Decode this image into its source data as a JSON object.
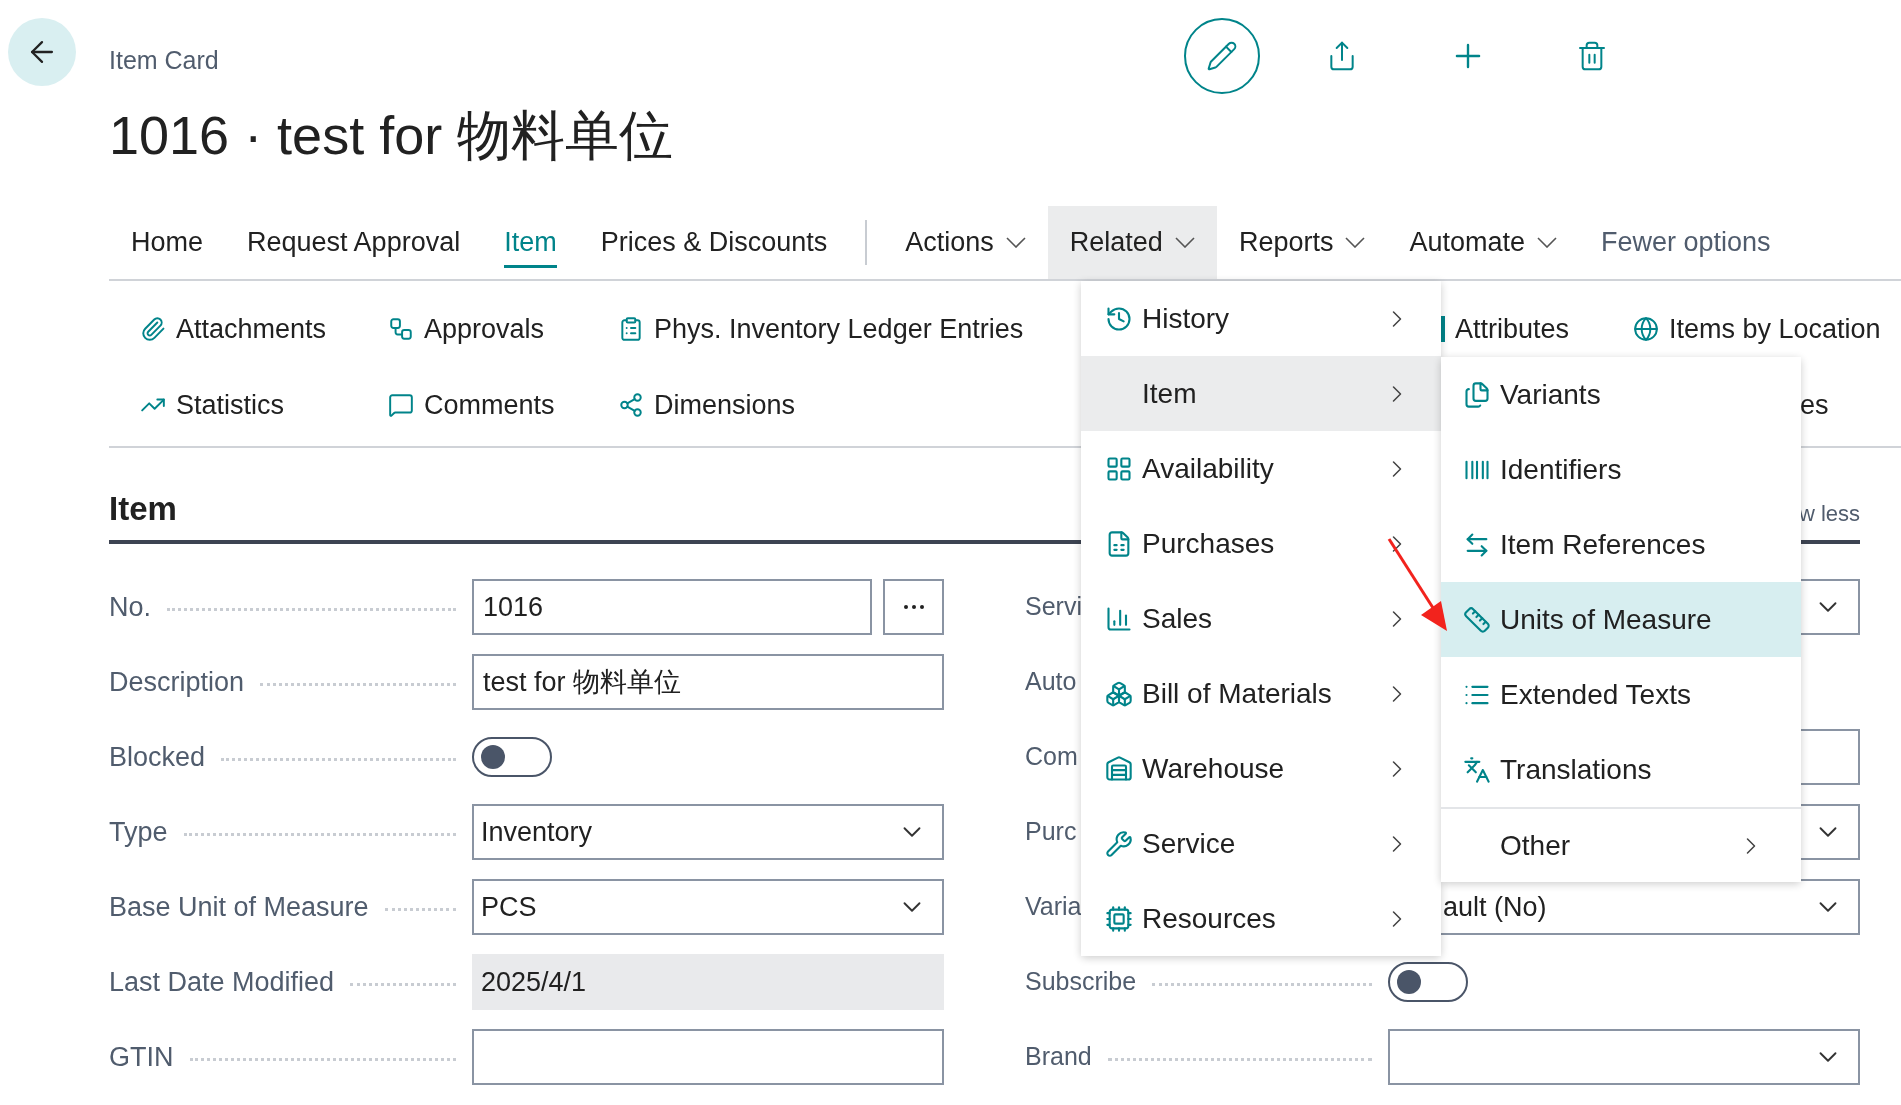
{
  "breadcrumb": "Item Card",
  "title": "1016 · test for 物料单位",
  "tabs": [
    {
      "label": "Home",
      "kind": "plain",
      "selected": false
    },
    {
      "label": "Request Approval",
      "kind": "plain",
      "selected": false
    },
    {
      "label": "Item",
      "kind": "plain",
      "selected": true
    },
    {
      "label": "Prices & Discounts",
      "kind": "plain",
      "selected": false
    },
    {
      "kind": "separator"
    },
    {
      "label": "Actions",
      "kind": "menu",
      "selected": false,
      "expanded": false
    },
    {
      "label": "Related",
      "kind": "menu",
      "selected": false,
      "expanded": true
    },
    {
      "label": "Reports",
      "kind": "menu",
      "selected": false,
      "expanded": false
    },
    {
      "label": "Automate",
      "kind": "menu",
      "selected": false,
      "expanded": false
    },
    {
      "label": "Fewer options",
      "kind": "link"
    }
  ],
  "action_rows": [
    [
      {
        "label": "Attachments"
      },
      {
        "label": "Approvals"
      },
      {
        "label": "Phys. Inventory Ledger Entries"
      },
      {
        "label": "Attributes"
      },
      {
        "label": "Items by Location"
      }
    ],
    [
      {
        "label": "Statistics"
      },
      {
        "label": "Comments"
      },
      {
        "label": "Dimensions"
      },
      {
        "label": "es"
      }
    ]
  ],
  "section": {
    "title": "Item",
    "toggle_text": "w less"
  },
  "left_fields": [
    {
      "label": "No.",
      "kind": "lookup",
      "value": "1016"
    },
    {
      "label": "Description",
      "kind": "text",
      "value": "test for 物料单位"
    },
    {
      "label": "Blocked",
      "kind": "toggle",
      "on": false
    },
    {
      "label": "Type",
      "kind": "dropdown",
      "value": "Inventory"
    },
    {
      "label": "Base Unit of Measure",
      "kind": "dropdown",
      "value": "PCS"
    },
    {
      "label": "Last Date Modified",
      "kind": "readonly",
      "value": "2025/4/1"
    },
    {
      "label": "GTIN",
      "kind": "text"
    }
  ],
  "right_fields": [
    {
      "label": "Servi",
      "kind": "dropdown"
    },
    {
      "label": "Auto",
      "kind": "hidden"
    },
    {
      "label": "Com",
      "kind": "text"
    },
    {
      "label": "Purc",
      "kind": "dropdown"
    },
    {
      "label": "Varia",
      "kind": "dropdown",
      "value": "ault (No)"
    },
    {
      "label": "Subscribe",
      "kind": "toggle",
      "on": false
    },
    {
      "label": "Brand",
      "kind": "dropdown"
    }
  ],
  "related_menu": [
    {
      "label": "History",
      "selected": false
    },
    {
      "label": "Item",
      "selected": true
    },
    {
      "label": "Availability",
      "selected": false
    },
    {
      "label": "Purchases",
      "selected": false
    },
    {
      "label": "Sales",
      "selected": false
    },
    {
      "label": "Bill of Materials",
      "selected": false
    },
    {
      "label": "Warehouse",
      "selected": false
    },
    {
      "label": "Service",
      "selected": false
    },
    {
      "label": "Resources",
      "selected": false
    }
  ],
  "item_submenu": [
    {
      "label": "Variants",
      "kind": "action",
      "selected": false
    },
    {
      "label": "Identifiers",
      "kind": "action",
      "selected": false
    },
    {
      "label": "Item References",
      "kind": "action",
      "selected": false
    },
    {
      "label": "Units of Measure",
      "kind": "action",
      "selected": true
    },
    {
      "label": "Extended Texts",
      "kind": "action",
      "selected": false
    },
    {
      "label": "Translations",
      "kind": "action",
      "selected": false
    },
    {
      "label": "Other",
      "kind": "submenu",
      "selected": false
    }
  ]
}
